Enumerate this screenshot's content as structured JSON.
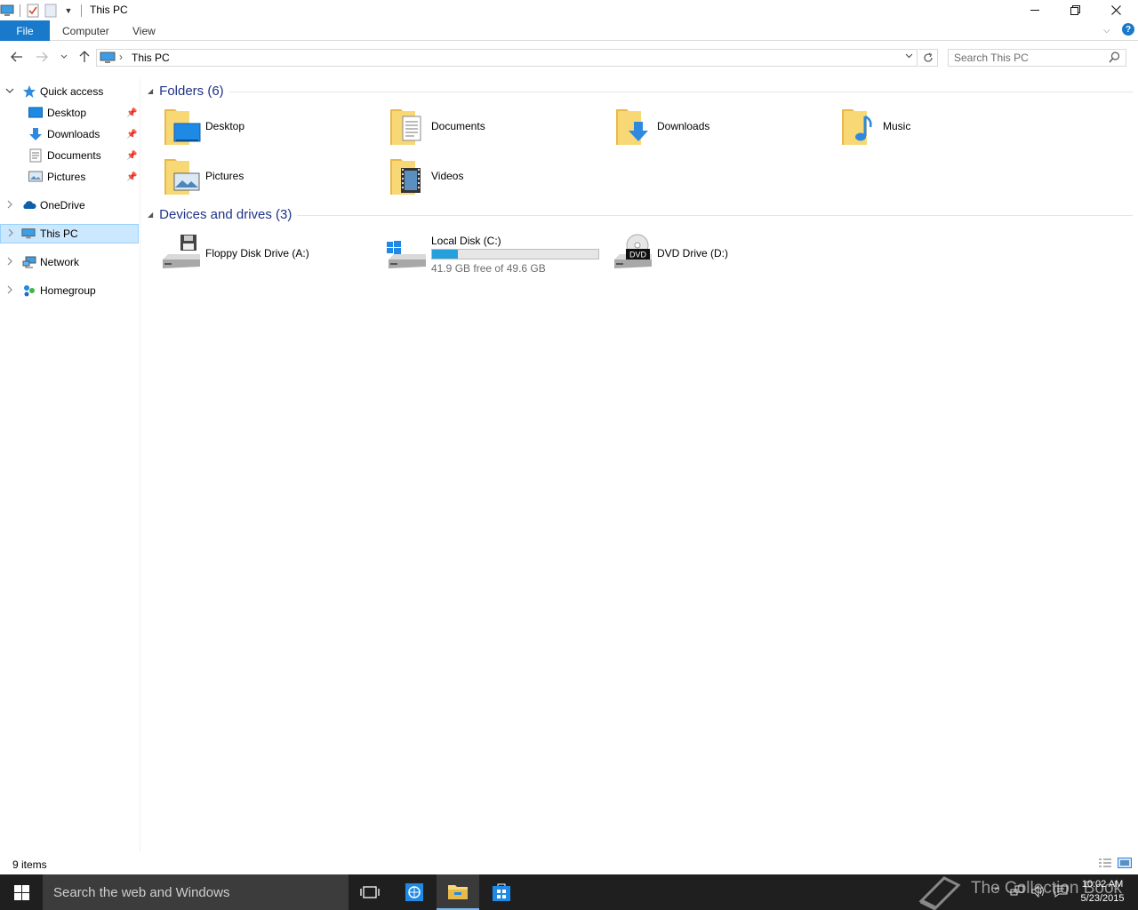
{
  "window": {
    "title": "This PC"
  },
  "ribbon": {
    "file": "File",
    "tabs": [
      "Computer",
      "View"
    ],
    "help": "?"
  },
  "address": {
    "path": "This PC"
  },
  "search": {
    "placeholder": "Search This PC"
  },
  "nav": {
    "quick_access": "Quick access",
    "quick_items": [
      "Desktop",
      "Downloads",
      "Documents",
      "Pictures"
    ],
    "onedrive": "OneDrive",
    "this_pc": "This PC",
    "network": "Network",
    "homegroup": "Homegroup"
  },
  "folders": {
    "header": "Folders (6)",
    "items": [
      "Desktop",
      "Documents",
      "Downloads",
      "Music",
      "Pictures",
      "Videos"
    ]
  },
  "devices": {
    "header": "Devices and drives (3)",
    "floppy": "Floppy Disk Drive (A:)",
    "local": {
      "name": "Local Disk (C:)",
      "free": "41.9 GB free of 49.6 GB",
      "used_fraction": 0.155
    },
    "dvd": {
      "name": "DVD Drive (D:)",
      "badge": "DVD"
    }
  },
  "status": {
    "count": "9 items"
  },
  "taskbar": {
    "search": "Search the web and Windows",
    "time": "10:02 AM",
    "date": "5/23/2015"
  },
  "watermark": "The Collection Book",
  "colors": {
    "accent": "#1979ca",
    "folder": "#f8d775",
    "selection": "#cce8ff",
    "bar": "#26a0da"
  }
}
